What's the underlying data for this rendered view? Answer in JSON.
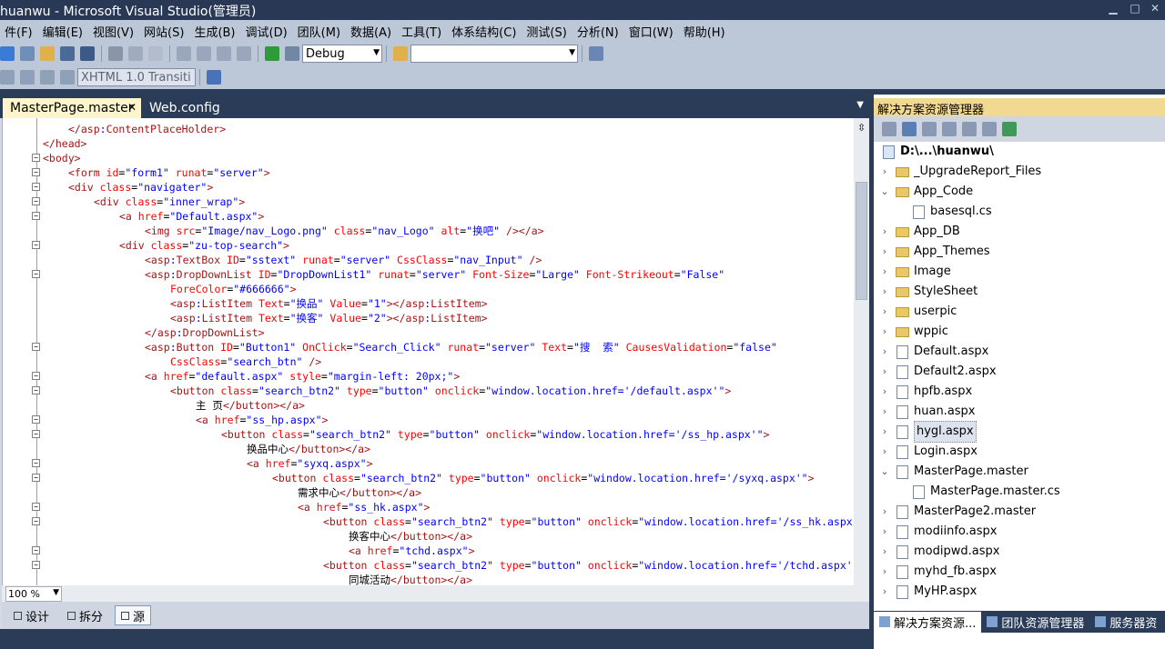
{
  "window": {
    "title": "huanwu - Microsoft Visual Studio(管理员)"
  },
  "menu": [
    "件(F)",
    "编辑(E)",
    "视图(V)",
    "网站(S)",
    "生成(B)",
    "调试(D)",
    "团队(M)",
    "数据(A)",
    "工具(T)",
    "体系结构(C)",
    "测试(S)",
    "分析(N)",
    "窗口(W)",
    "帮助(H)"
  ],
  "toolbar": {
    "config_value": "Debug",
    "search_value": "",
    "schema_value": "XHTML 1.0 Transiti"
  },
  "tabs": [
    {
      "label": "MasterPage.master",
      "active": true
    },
    {
      "label": "Web.config",
      "active": false
    }
  ],
  "code_lines": [
    {
      "indent": 4,
      "parts": [
        [
          "tg",
          "</"
        ],
        [
          "tg",
          "asp"
        ],
        [
          "pu",
          ":"
        ],
        [
          "tg",
          "ContentPlaceHolder"
        ],
        [
          "tg",
          ">"
        ]
      ]
    },
    {
      "indent": 0,
      "parts": [
        [
          "tg",
          "</head>"
        ]
      ]
    },
    {
      "indent": 0,
      "parts": [
        [
          "tg",
          "<body>"
        ]
      ],
      "fold": "-"
    },
    {
      "indent": 4,
      "parts": [
        [
          "tg",
          "<form "
        ],
        [
          "at",
          "id"
        ],
        [
          "tx",
          "="
        ],
        [
          "vl",
          "\"form1\""
        ],
        [
          "tx",
          " "
        ],
        [
          "at",
          "runat"
        ],
        [
          "tx",
          "="
        ],
        [
          "vl",
          "\"server\""
        ],
        [
          "tg",
          ">"
        ]
      ],
      "fold": "-"
    },
    {
      "indent": 4,
      "parts": [
        [
          "tg",
          "<div "
        ],
        [
          "at",
          "class"
        ],
        [
          "tx",
          "="
        ],
        [
          "vl",
          "\"navigater\""
        ],
        [
          "tg",
          ">"
        ]
      ],
      "fold": "-"
    },
    {
      "indent": 8,
      "parts": [
        [
          "tg",
          "<div "
        ],
        [
          "at",
          "class"
        ],
        [
          "tx",
          "="
        ],
        [
          "vl",
          "\"inner_wrap\""
        ],
        [
          "tg",
          ">"
        ]
      ],
      "fold": "-"
    },
    {
      "indent": 12,
      "parts": [
        [
          "tg",
          "<a "
        ],
        [
          "at",
          "href"
        ],
        [
          "tx",
          "="
        ],
        [
          "vl",
          "\"Default.aspx\""
        ],
        [
          "tg",
          ">"
        ]
      ],
      "fold": "-"
    },
    {
      "indent": 16,
      "parts": [
        [
          "tg",
          "<img "
        ],
        [
          "at",
          "src"
        ],
        [
          "tx",
          "="
        ],
        [
          "vl",
          "\"Image/nav_Logo.png\""
        ],
        [
          "tx",
          " "
        ],
        [
          "at",
          "class"
        ],
        [
          "tx",
          "="
        ],
        [
          "vl",
          "\"nav_Logo\""
        ],
        [
          "tx",
          " "
        ],
        [
          "at",
          "alt"
        ],
        [
          "tx",
          "="
        ],
        [
          "vl",
          "\"换吧\""
        ],
        [
          "tx",
          " "
        ],
        [
          "tg",
          "/></a>"
        ]
      ]
    },
    {
      "indent": 12,
      "parts": [
        [
          "tg",
          "<div "
        ],
        [
          "at",
          "class"
        ],
        [
          "tx",
          "="
        ],
        [
          "vl",
          "\"zu-top-search\""
        ],
        [
          "tg",
          ">"
        ]
      ],
      "fold": "-"
    },
    {
      "indent": 16,
      "parts": [
        [
          "tg",
          "<asp"
        ],
        [
          "pu",
          ":"
        ],
        [
          "tg",
          "TextBox "
        ],
        [
          "at",
          "ID"
        ],
        [
          "tx",
          "="
        ],
        [
          "vl",
          "\"sstext\""
        ],
        [
          "tx",
          " "
        ],
        [
          "at",
          "runat"
        ],
        [
          "tx",
          "="
        ],
        [
          "vl",
          "\"server\""
        ],
        [
          "tx",
          " "
        ],
        [
          "at",
          "CssClass"
        ],
        [
          "tx",
          "="
        ],
        [
          "vl",
          "\"nav_Input\""
        ],
        [
          "tx",
          " "
        ],
        [
          "tg",
          "/>"
        ]
      ]
    },
    {
      "indent": 16,
      "parts": [
        [
          "tg",
          "<asp"
        ],
        [
          "pu",
          ":"
        ],
        [
          "tg",
          "DropDownList "
        ],
        [
          "at",
          "ID"
        ],
        [
          "tx",
          "="
        ],
        [
          "vl",
          "\"DropDownList1\""
        ],
        [
          "tx",
          " "
        ],
        [
          "at",
          "runat"
        ],
        [
          "tx",
          "="
        ],
        [
          "vl",
          "\"server\""
        ],
        [
          "tx",
          " "
        ],
        [
          "at",
          "Font-Size"
        ],
        [
          "tx",
          "="
        ],
        [
          "vl",
          "\"Large\""
        ],
        [
          "tx",
          " "
        ],
        [
          "at",
          "Font-Strikeout"
        ],
        [
          "tx",
          "="
        ],
        [
          "vl",
          "\"False\""
        ]
      ],
      "fold": "-"
    },
    {
      "indent": 20,
      "parts": [
        [
          "at",
          "ForeColor"
        ],
        [
          "tx",
          "="
        ],
        [
          "vl",
          "\"#666666\""
        ],
        [
          "tg",
          ">"
        ]
      ]
    },
    {
      "indent": 20,
      "parts": [
        [
          "tg",
          "<asp"
        ],
        [
          "pu",
          ":"
        ],
        [
          "tg",
          "ListItem "
        ],
        [
          "at",
          "Text"
        ],
        [
          "tx",
          "="
        ],
        [
          "vl",
          "\"换品\""
        ],
        [
          "tx",
          " "
        ],
        [
          "at",
          "Value"
        ],
        [
          "tx",
          "="
        ],
        [
          "vl",
          "\"1\""
        ],
        [
          "tg",
          "></"
        ],
        [
          "tg",
          "asp"
        ],
        [
          "pu",
          ":"
        ],
        [
          "tg",
          "ListItem>"
        ]
      ]
    },
    {
      "indent": 20,
      "parts": [
        [
          "tg",
          "<asp"
        ],
        [
          "pu",
          ":"
        ],
        [
          "tg",
          "ListItem "
        ],
        [
          "at",
          "Text"
        ],
        [
          "tx",
          "="
        ],
        [
          "vl",
          "\"换客\""
        ],
        [
          "tx",
          " "
        ],
        [
          "at",
          "Value"
        ],
        [
          "tx",
          "="
        ],
        [
          "vl",
          "\"2\""
        ],
        [
          "tg",
          "></"
        ],
        [
          "tg",
          "asp"
        ],
        [
          "pu",
          ":"
        ],
        [
          "tg",
          "ListItem>"
        ]
      ]
    },
    {
      "indent": 16,
      "parts": [
        [
          "tg",
          "</"
        ],
        [
          "tg",
          "asp"
        ],
        [
          "pu",
          ":"
        ],
        [
          "tg",
          "DropDownList>"
        ]
      ]
    },
    {
      "indent": 16,
      "parts": [
        [
          "tg",
          "<asp"
        ],
        [
          "pu",
          ":"
        ],
        [
          "tg",
          "Button "
        ],
        [
          "at",
          "ID"
        ],
        [
          "tx",
          "="
        ],
        [
          "vl",
          "\"Button1\""
        ],
        [
          "tx",
          " "
        ],
        [
          "at",
          "OnClick"
        ],
        [
          "tx",
          "="
        ],
        [
          "vl",
          "\"Search_Click\""
        ],
        [
          "tx",
          " "
        ],
        [
          "at",
          "runat"
        ],
        [
          "tx",
          "="
        ],
        [
          "vl",
          "\"server\""
        ],
        [
          "tx",
          " "
        ],
        [
          "at",
          "Text"
        ],
        [
          "tx",
          "="
        ],
        [
          "vl",
          "\"搜  索\""
        ],
        [
          "tx",
          " "
        ],
        [
          "at",
          "CausesValidation"
        ],
        [
          "tx",
          "="
        ],
        [
          "vl",
          "\"false\""
        ]
      ],
      "fold": "-"
    },
    {
      "indent": 20,
      "parts": [
        [
          "at",
          "CssClass"
        ],
        [
          "tx",
          "="
        ],
        [
          "vl",
          "\"search_btn\""
        ],
        [
          "tx",
          " "
        ],
        [
          "tg",
          "/>"
        ]
      ]
    },
    {
      "indent": 16,
      "parts": [
        [
          "tg",
          "<a "
        ],
        [
          "at",
          "href"
        ],
        [
          "tx",
          "="
        ],
        [
          "vl",
          "\"default.aspx\""
        ],
        [
          "tx",
          " "
        ],
        [
          "at",
          "style"
        ],
        [
          "tx",
          "="
        ],
        [
          "vl",
          "\"margin-left: 20px;\""
        ],
        [
          "tg",
          ">"
        ]
      ],
      "fold": "-"
    },
    {
      "indent": 20,
      "parts": [
        [
          "tg",
          "<button "
        ],
        [
          "at",
          "class"
        ],
        [
          "tx",
          "="
        ],
        [
          "vl",
          "\"search_btn2\""
        ],
        [
          "tx",
          " "
        ],
        [
          "at",
          "type"
        ],
        [
          "tx",
          "="
        ],
        [
          "vl",
          "\"button\""
        ],
        [
          "tx",
          " "
        ],
        [
          "at",
          "onclick"
        ],
        [
          "tx",
          "="
        ],
        [
          "vl",
          "\"window.location.href='/default.aspx'\""
        ],
        [
          "tg",
          ">"
        ]
      ],
      "fold": "-"
    },
    {
      "indent": 24,
      "parts": [
        [
          "tx",
          "主 页"
        ],
        [
          "tg",
          "</button></a>"
        ]
      ]
    },
    {
      "indent": 24,
      "parts": [
        [
          "tg",
          "<a "
        ],
        [
          "at",
          "href"
        ],
        [
          "tx",
          "="
        ],
        [
          "vl",
          "\"ss_hp.aspx\""
        ],
        [
          "tg",
          ">"
        ]
      ],
      "fold": "-"
    },
    {
      "indent": 28,
      "parts": [
        [
          "tg",
          "<button "
        ],
        [
          "at",
          "class"
        ],
        [
          "tx",
          "="
        ],
        [
          "vl",
          "\"search_btn2\""
        ],
        [
          "tx",
          " "
        ],
        [
          "at",
          "type"
        ],
        [
          "tx",
          "="
        ],
        [
          "vl",
          "\"button\""
        ],
        [
          "tx",
          " "
        ],
        [
          "at",
          "onclick"
        ],
        [
          "tx",
          "="
        ],
        [
          "vl",
          "\"window.location.href='/ss_hp.aspx'\""
        ],
        [
          "tg",
          ">"
        ]
      ],
      "fold": "-"
    },
    {
      "indent": 32,
      "parts": [
        [
          "tx",
          "换品中心"
        ],
        [
          "tg",
          "</button></a>"
        ]
      ]
    },
    {
      "indent": 32,
      "parts": [
        [
          "tg",
          "<a "
        ],
        [
          "at",
          "href"
        ],
        [
          "tx",
          "="
        ],
        [
          "vl",
          "\"syxq.aspx\""
        ],
        [
          "tg",
          ">"
        ]
      ],
      "fold": "-"
    },
    {
      "indent": 36,
      "parts": [
        [
          "tg",
          "<button "
        ],
        [
          "at",
          "class"
        ],
        [
          "tx",
          "="
        ],
        [
          "vl",
          "\"search_btn2\""
        ],
        [
          "tx",
          " "
        ],
        [
          "at",
          "type"
        ],
        [
          "tx",
          "="
        ],
        [
          "vl",
          "\"button\""
        ],
        [
          "tx",
          " "
        ],
        [
          "at",
          "onclick"
        ],
        [
          "tx",
          "="
        ],
        [
          "vl",
          "\"window.location.href='/syxq.aspx'\""
        ],
        [
          "tg",
          ">"
        ]
      ],
      "fold": "-"
    },
    {
      "indent": 40,
      "parts": [
        [
          "tx",
          "需求中心"
        ],
        [
          "tg",
          "</button></a>"
        ]
      ]
    },
    {
      "indent": 40,
      "parts": [
        [
          "tg",
          "<a "
        ],
        [
          "at",
          "href"
        ],
        [
          "tx",
          "="
        ],
        [
          "vl",
          "\"ss_hk.aspx\""
        ],
        [
          "tg",
          ">"
        ]
      ],
      "fold": "-"
    },
    {
      "indent": 44,
      "parts": [
        [
          "tg",
          "<button "
        ],
        [
          "at",
          "class"
        ],
        [
          "tx",
          "="
        ],
        [
          "vl",
          "\"search_btn2\""
        ],
        [
          "tx",
          " "
        ],
        [
          "at",
          "type"
        ],
        [
          "tx",
          "="
        ],
        [
          "vl",
          "\"button\""
        ],
        [
          "tx",
          " "
        ],
        [
          "at",
          "onclick"
        ],
        [
          "tx",
          "="
        ],
        [
          "vl",
          "\"window.location.href='/ss_hk.aspx"
        ]
      ],
      "fold": "-"
    },
    {
      "indent": 48,
      "parts": [
        [
          "tx",
          "换客中心"
        ],
        [
          "tg",
          "</button></a>"
        ]
      ]
    },
    {
      "indent": 48,
      "parts": [
        [
          "tg",
          "<a "
        ],
        [
          "at",
          "href"
        ],
        [
          "tx",
          "="
        ],
        [
          "vl",
          "\"tchd.aspx\""
        ],
        [
          "tg",
          ">"
        ]
      ],
      "fold": "-"
    },
    {
      "indent": 44,
      "parts": [
        [
          "tg",
          "<button "
        ],
        [
          "at",
          "class"
        ],
        [
          "tx",
          "="
        ],
        [
          "vl",
          "\"search_btn2\""
        ],
        [
          "tx",
          " "
        ],
        [
          "at",
          "type"
        ],
        [
          "tx",
          "="
        ],
        [
          "vl",
          "\"button\""
        ],
        [
          "tx",
          " "
        ],
        [
          "at",
          "onclick"
        ],
        [
          "tx",
          "="
        ],
        [
          "vl",
          "\"window.location.href='/tchd.aspx'"
        ]
      ],
      "fold": "-"
    },
    {
      "indent": 48,
      "parts": [
        [
          "tx",
          "同城活动"
        ],
        [
          "tg",
          "</button></a>"
        ]
      ]
    }
  ],
  "editor": {
    "zoom": "100 %",
    "views": [
      "设计",
      "拆分",
      "源"
    ],
    "active_view": "源"
  },
  "solution_explorer": {
    "title": "解决方案资源管理器",
    "root": "D:\\...\\huanwu\\",
    "items": [
      {
        "label": "_UpgradeReport_Files",
        "kind": "folder",
        "level": 1,
        "chev": ">"
      },
      {
        "label": "App_Code",
        "kind": "folder",
        "level": 1,
        "chev": "v"
      },
      {
        "label": "basesql.cs",
        "kind": "file",
        "level": 2,
        "chev": ""
      },
      {
        "label": "App_DB",
        "kind": "folder",
        "level": 1,
        "chev": ">"
      },
      {
        "label": "App_Themes",
        "kind": "folder",
        "level": 1,
        "chev": ">"
      },
      {
        "label": "Image",
        "kind": "folder",
        "level": 1,
        "chev": ">"
      },
      {
        "label": "StyleSheet",
        "kind": "folder",
        "level": 1,
        "chev": ">"
      },
      {
        "label": "userpic",
        "kind": "folder",
        "level": 1,
        "chev": ">"
      },
      {
        "label": "wppic",
        "kind": "folder",
        "level": 1,
        "chev": ">"
      },
      {
        "label": "Default.aspx",
        "kind": "file",
        "level": 1,
        "chev": ">"
      },
      {
        "label": "Default2.aspx",
        "kind": "file",
        "level": 1,
        "chev": ">"
      },
      {
        "label": "hpfb.aspx",
        "kind": "file",
        "level": 1,
        "chev": ">"
      },
      {
        "label": "huan.aspx",
        "kind": "file",
        "level": 1,
        "chev": ">"
      },
      {
        "label": "hygl.aspx",
        "kind": "file",
        "level": 1,
        "chev": ">",
        "selected": true
      },
      {
        "label": "Login.aspx",
        "kind": "file",
        "level": 1,
        "chev": ">"
      },
      {
        "label": "MasterPage.master",
        "kind": "file",
        "level": 1,
        "chev": "v"
      },
      {
        "label": "MasterPage.master.cs",
        "kind": "file",
        "level": 2,
        "chev": ""
      },
      {
        "label": "MasterPage2.master",
        "kind": "file",
        "level": 1,
        "chev": ">"
      },
      {
        "label": "modiinfo.aspx",
        "kind": "file",
        "level": 1,
        "chev": ">"
      },
      {
        "label": "modipwd.aspx",
        "kind": "file",
        "level": 1,
        "chev": ">"
      },
      {
        "label": "myhd_fb.aspx",
        "kind": "file",
        "level": 1,
        "chev": ">"
      },
      {
        "label": "MyHP.aspx",
        "kind": "file",
        "level": 1,
        "chev": ">"
      }
    ],
    "bottom_tabs": [
      "解决方案资源...",
      "团队资源管理器",
      "服务器资"
    ]
  }
}
